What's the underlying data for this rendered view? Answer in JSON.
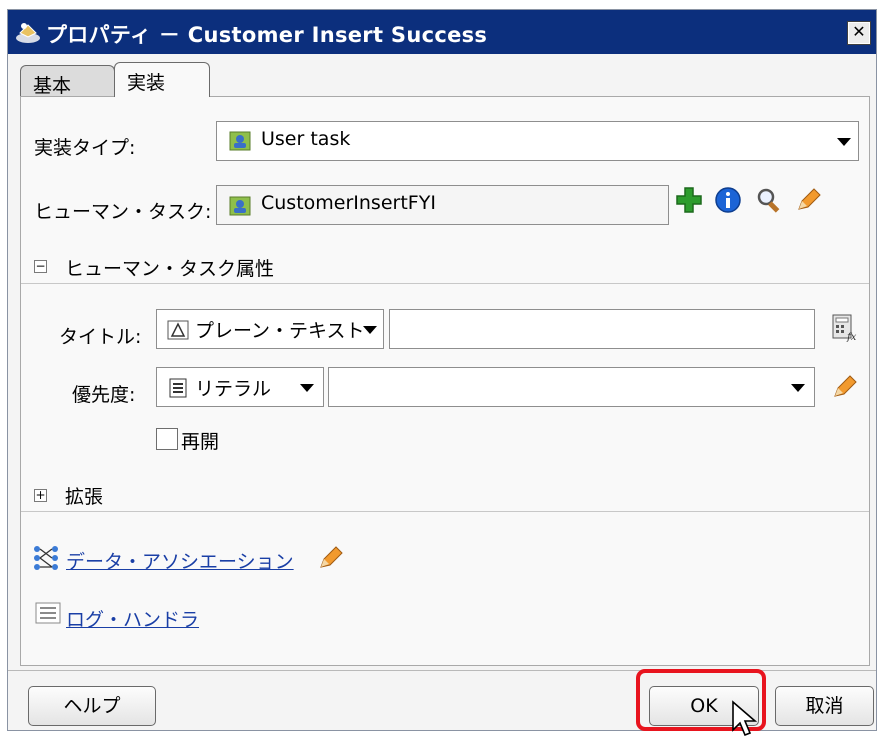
{
  "window": {
    "title": "プロパティ － Customer Insert Success",
    "close_label": "✕"
  },
  "tabs": [
    {
      "label": "基本",
      "active": false
    },
    {
      "label": "実装",
      "active": true
    }
  ],
  "form": {
    "impl_type_label": "実装タイプ:",
    "impl_type_value": "User task",
    "human_task_label": "ヒューマン・タスク:",
    "human_task_value": "CustomerInsertFYI"
  },
  "attributes_section": {
    "expander": "−",
    "title": "ヒューマン・タスク属性",
    "title_field_label": "タイトル:",
    "title_mode_value": "プレーン・テキスト",
    "title_value": "",
    "priority_label": "優先度:",
    "priority_mode_value": "リテラル",
    "priority_value": "",
    "reopen_label": "再開",
    "reopen_checked": false
  },
  "extension_section": {
    "expander": "+",
    "title": "拡張"
  },
  "links": {
    "data_association": "データ・アソシエーション",
    "log_handler": "ログ・ハンドラ"
  },
  "buttons": {
    "help": "ヘルプ",
    "ok": "OK",
    "cancel": "取消"
  },
  "colors": {
    "titlebar": "#0c2f7d",
    "highlight": "#e8141e",
    "link": "#1a3fa6",
    "add_icon": "#2e9c2e",
    "info_icon": "#1c64d6"
  },
  "icons": [
    "app-icon",
    "user-task-icon",
    "add-icon",
    "info-icon",
    "search-icon",
    "edit-pencil-icon",
    "expression-builder-icon",
    "literal-list-icon",
    "data-association-icon",
    "log-handler-icon",
    "cursor-icon"
  ]
}
